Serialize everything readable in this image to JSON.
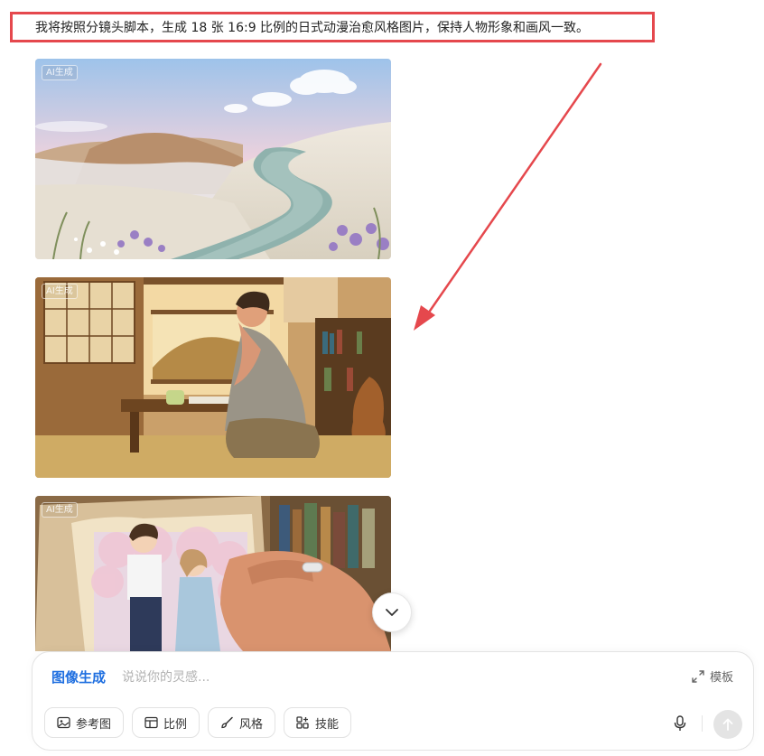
{
  "message": {
    "text": "我将按照分镜头脚本，生成 18 张 16:9 比例的日式动漫治愈风格图片，保持人物形象和画风一致。",
    "highlight_color": "#e5484d"
  },
  "images": [
    {
      "tag": "AI生成",
      "subject": "mountain-path-landscape"
    },
    {
      "tag": "AI生成",
      "subject": "man-at-tea-table"
    },
    {
      "tag": "AI生成",
      "subject": "hand-holding-photo"
    }
  ],
  "annotation_arrow_color": "#e5484d",
  "composer": {
    "mode_label": "图像生成",
    "placeholder": "说说你的灵感...",
    "template_label": "模板",
    "tools": [
      {
        "label": "参考图",
        "icon": "image-icon"
      },
      {
        "label": "比例",
        "icon": "ratio-icon"
      },
      {
        "label": "风格",
        "icon": "brush-icon"
      },
      {
        "label": "技能",
        "icon": "skills-icon"
      }
    ],
    "accent_color": "#1f6fe0"
  }
}
